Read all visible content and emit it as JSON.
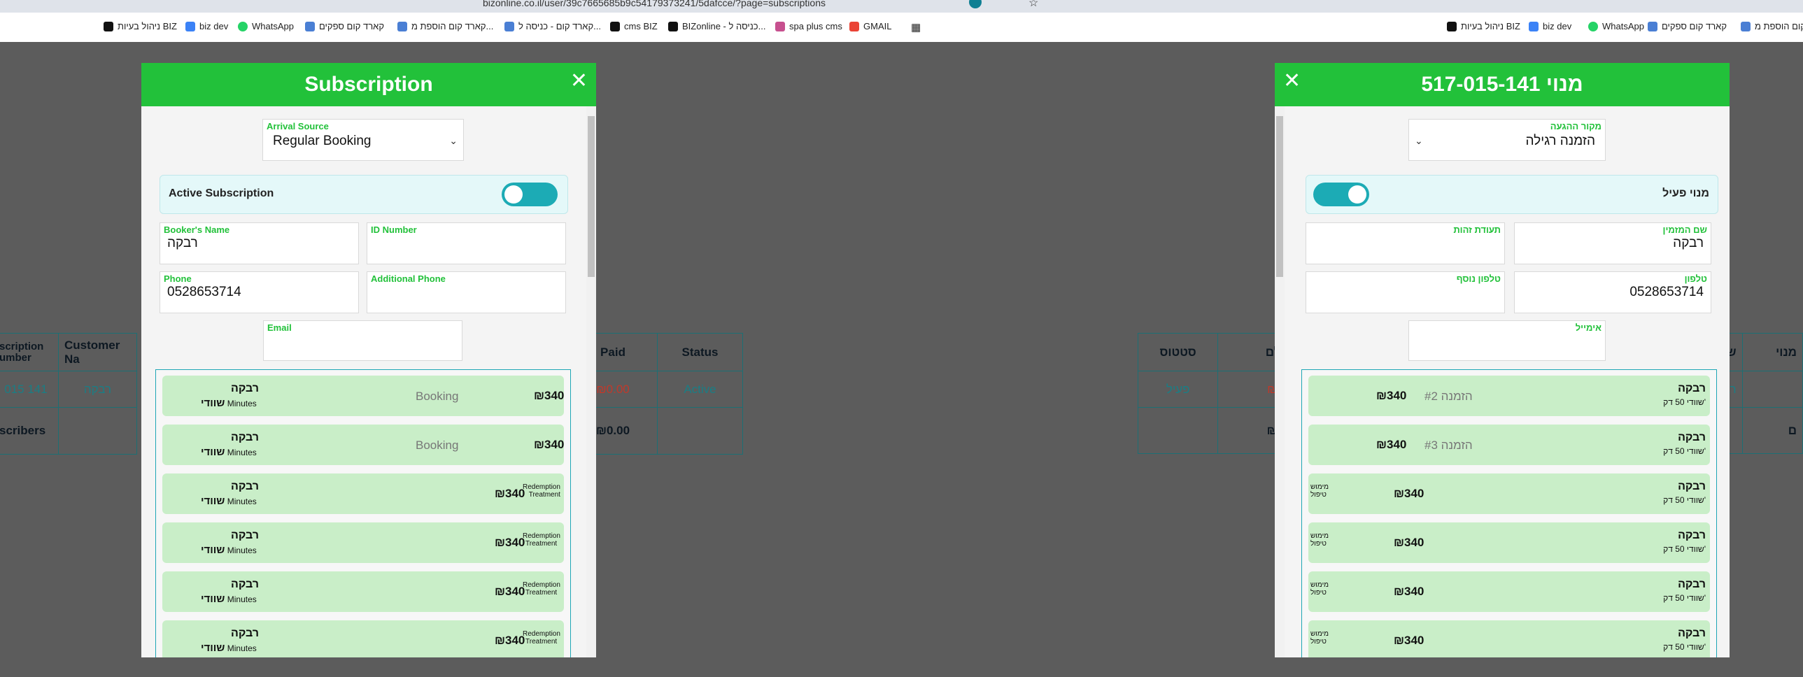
{
  "browser": {
    "url_left": "bizonline.co.il/user/39c7665685b9c54179373241/5dafcce/?page=subscriptions",
    "bookmarks_left": [
      "ניהול בעיות BIZ",
      "biz dev",
      "WhatsApp",
      "קארד קום ספקים",
      "קארד קום הוספת מ...",
      "קארד קום - כניסה ל...",
      "cms BIZ",
      "BIZonline - כניסה ל...",
      "spa plus cms",
      "GMAIL"
    ],
    "bookmarks_right": [
      "ניהול בעיות BIZ",
      "biz dev",
      "WhatsApp",
      "קארד קום ספקים",
      "קארד קום הוספת מ..."
    ]
  },
  "bg_table_left": {
    "headers": [
      "scription\\number",
      "Customer Na",
      "Paid",
      "Status"
    ],
    "row": [
      "015 141",
      "רבקה",
      "₪0.00",
      "Active"
    ],
    "footer": [
      "scribers",
      "",
      "₪0.00",
      ""
    ]
  },
  "bg_table_right": {
    "headers": [
      "סטטוס",
      "שולם",
      "שם ל",
      "מנוי"
    ],
    "row": [
      "פעיל",
      "₪0.0",
      "רבק",
      ""
    ],
    "footer": [
      "",
      "₪0.0",
      "",
      "ם"
    ]
  },
  "modal_en": {
    "title": "Subscription",
    "arrival_label": "Arrival Source",
    "arrival_value": "Regular Booking",
    "active_label": "Active Subscription",
    "booker_label": "Booker's Name",
    "booker_value": "רבקה",
    "id_label": "ID Number",
    "id_value": "",
    "phone_label": "Phone",
    "phone_value": "0528653714",
    "add_phone_label": "Additional Phone",
    "add_phone_value": "",
    "email_label": "Email",
    "email_value": "",
    "items": [
      {
        "name": "רבקה",
        "svc": "שוודי",
        "unit": "Minutes",
        "type": "Booking",
        "price": "₪340"
      },
      {
        "name": "רבקה",
        "svc": "שוודי",
        "unit": "Minutes",
        "type": "Booking",
        "price": "₪340"
      },
      {
        "name": "רבקה",
        "svc": "שוודי",
        "unit": "Minutes",
        "price": "₪340",
        "r1": "Redemption",
        "r2": "Treatment"
      },
      {
        "name": "רבקה",
        "svc": "שוודי",
        "unit": "Minutes",
        "price": "₪340",
        "r1": "Redemption",
        "r2": "Treatment"
      },
      {
        "name": "רבקה",
        "svc": "שוודי",
        "unit": "Minutes",
        "price": "₪340",
        "r1": "Redemption",
        "r2": "Treatment"
      },
      {
        "name": "רבקה",
        "svc": "שוודי",
        "unit": "Minutes",
        "price": "₪340",
        "r1": "Redemption",
        "r2": "Treatment"
      }
    ]
  },
  "modal_he": {
    "title": "מנוי 517-015-141",
    "arrival_label": "מקור ההגעה",
    "arrival_value": "הזמנה רגילה",
    "active_label": "מנוי פעיל",
    "booker_label": "שם המזמין",
    "booker_value": "רבקה",
    "id_label": "תעודת זהות",
    "id_value": "",
    "phone_label": "טלפון",
    "phone_value": "0528653714",
    "add_phone_label": "טלפון נוסף",
    "add_phone_value": "",
    "email_label": "אימייל",
    "email_value": "",
    "items": [
      {
        "name": "רבקה",
        "svc": "שוודי 50 דק'",
        "type": "הזמנה #2",
        "price": "₪340"
      },
      {
        "name": "רבקה",
        "svc": "שוודי 50 דק'",
        "type": "הזמנה #3",
        "price": "₪340"
      },
      {
        "name": "רבקה",
        "svc": "שוודי 50 דק'",
        "price": "₪340",
        "r1": "מימוש",
        "r2": "טיפול"
      },
      {
        "name": "רבקה",
        "svc": "שוודי 50 דק'",
        "price": "₪340",
        "r1": "מימוש",
        "r2": "טיפול"
      },
      {
        "name": "רבקה",
        "svc": "שוודי 50 דק'",
        "price": "₪340",
        "r1": "מימוש",
        "r2": "טיפול"
      },
      {
        "name": "רבקה",
        "svc": "שוודי 50 דק'",
        "price": "₪340",
        "r1": "מימוש",
        "r2": "טיפול"
      }
    ]
  },
  "colors": {
    "header_green": "#22c13a",
    "toggle_teal": "#1cabb5",
    "item_green": "#c9eec8",
    "paid_red": "#c0392b"
  }
}
